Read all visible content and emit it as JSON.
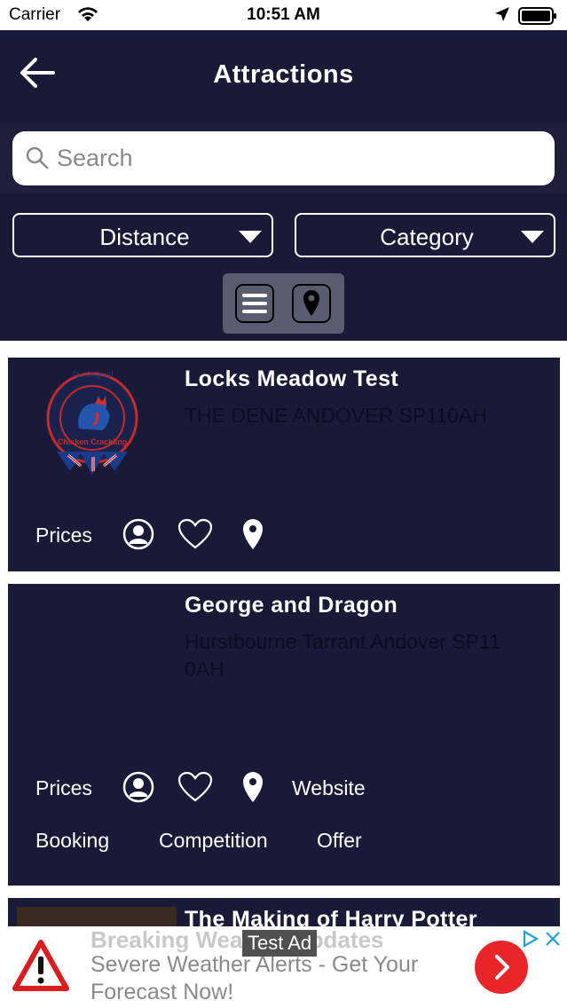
{
  "status_bar": {
    "carrier": "Carrier",
    "time": "10:51 AM"
  },
  "header": {
    "title": "Attractions",
    "back_icon": "arrow-left-icon"
  },
  "search": {
    "placeholder": "Search",
    "value": ""
  },
  "filters": {
    "distance": "Distance",
    "category": "Category"
  },
  "view_toggle": {
    "list_icon": "list-icon",
    "map_icon": "map-pin-icon"
  },
  "colors": {
    "header_bg": "#181a38",
    "card_bg": "#181a38",
    "toggle_bg": "#5a5c70",
    "ad_button": "#e8262a"
  },
  "attractions": [
    {
      "title": "Locks Meadow Test",
      "address": "THE DENE ANDOVER   SP110AH",
      "logo_text": [
        "The Original",
        "Chicken Crackling"
      ],
      "actions": {
        "prices": "Prices"
      }
    },
    {
      "title": "George and Dragon",
      "address": "Hurstbourne Tarrant Andover SP11 0AH",
      "actions": {
        "prices": "Prices",
        "website": "Website",
        "booking": "Booking",
        "competition": "Competition",
        "offer": "Offer"
      }
    },
    {
      "title": "The Making of Harry Potter"
    }
  ],
  "ad": {
    "title": "Breaking Weather Updates",
    "body": "Severe Weather Alerts - Get Your Forecast Now!",
    "tag": "Test Ad"
  }
}
